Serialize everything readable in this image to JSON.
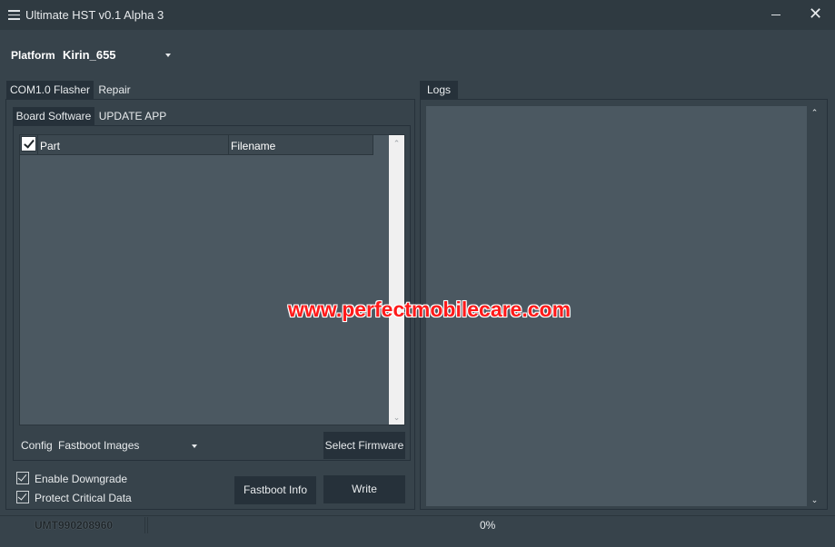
{
  "window": {
    "title": "Ultimate HST v0.1 Alpha 3",
    "close_glyph": "✕"
  },
  "platform": {
    "label": "Platform",
    "value": "Kirin_655"
  },
  "left_tabs": [
    {
      "label": "COM1.0 Flasher",
      "active": true
    },
    {
      "label": "Repair",
      "active": false
    }
  ],
  "inner_tabs": [
    {
      "label": "Board Software",
      "active": true
    },
    {
      "label": "UPDATE APP",
      "active": false
    }
  ],
  "table": {
    "select_all_checked": true,
    "columns": [
      "Part",
      "Filename"
    ],
    "rows": []
  },
  "scroll_glyphs": {
    "up": "⌃",
    "down": "⌄"
  },
  "config": {
    "label": "Config",
    "value": "Fastboot Images"
  },
  "buttons": {
    "select_firmware": "Select Firmware",
    "fastboot_info": "Fastboot Info",
    "write": "Write"
  },
  "options": [
    {
      "label": "Enable Downgrade",
      "checked": true
    },
    {
      "label": "Protect Critical Data",
      "checked": true
    }
  ],
  "logs": {
    "tab_label": "Logs",
    "content": ""
  },
  "status": {
    "serial": "UMT990208960",
    "progress_percent": 0,
    "progress_text": "0%"
  },
  "watermark": "www.perfectmobilecare.com",
  "colors": {
    "background": "#37434b",
    "titlebar": "#2f3a41",
    "panel_fill": "#4b5861",
    "button": "#26313a",
    "watermark": "#ff1a1a"
  }
}
